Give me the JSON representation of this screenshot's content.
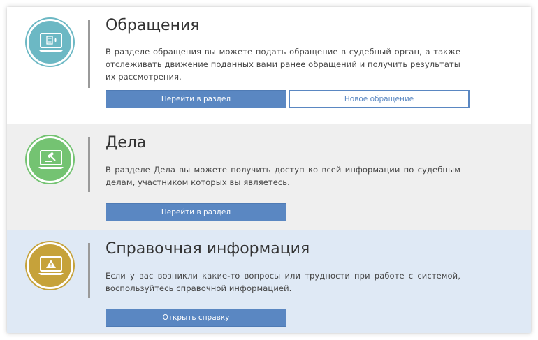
{
  "colors": {
    "appeals_accent": "#6cb8c4",
    "cases_accent": "#74c372",
    "reference_accent": "#c6a23a",
    "primary_button": "#5a87c2",
    "section_cases_bg": "#efefef",
    "section_reference_bg": "#dfe9f5"
  },
  "sections": {
    "appeals": {
      "icon": "laptop-document-plus-icon",
      "title": "Обращения",
      "description": "В разделе обращения вы можете подать обращение в судебный орган, а также отслеживать движение поданных вами ранее обращений и получить результаты их рассмотрения.",
      "primary_button": "Перейти в раздел",
      "secondary_button": "Новое обращение"
    },
    "cases": {
      "icon": "laptop-gavel-icon",
      "title": "Дела",
      "description": "В разделе Дела вы можете получить доступ ко всей информации по судебным делам, участником которых вы являетесь.",
      "primary_button": "Перейти в раздел"
    },
    "reference": {
      "icon": "laptop-warning-icon",
      "title": "Справочная информация",
      "description": "Если у вас возникли какие-то вопросы или трудности при работе с системой, воспользуйтесь справочной информацией.",
      "primary_button": "Открыть справку"
    }
  }
}
